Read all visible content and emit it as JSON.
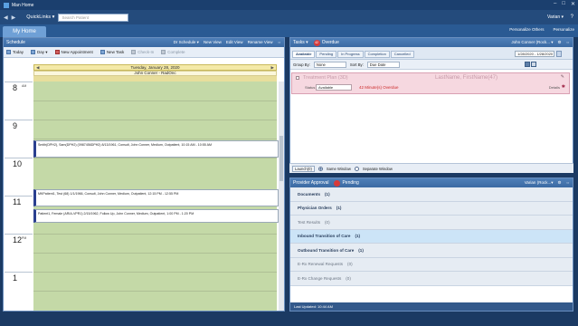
{
  "window": {
    "title": "Man Home",
    "controls": [
      "–",
      "□",
      "✕"
    ]
  },
  "toolbar": {
    "back": "◀",
    "forward": "▶",
    "quicklinks": "QuickLinks ▾",
    "search_placeholder": "Search Patient",
    "user": "Varian ▾",
    "help": "?"
  },
  "tabs": {
    "my_home": "My Home",
    "personalize_others": "Personalize Others",
    "personalize": "Personalize"
  },
  "schedule": {
    "title": "Schedule",
    "header_links": [
      "Dr Schedule ▾",
      "New View",
      "Edit View",
      "Rename View",
      "⇔"
    ],
    "tools": {
      "today": "Today",
      "view": "Day ▾",
      "new_appointment": "New Appointment",
      "new_task": "New Task",
      "check_in": "Check-In",
      "complete": "Complete"
    },
    "date": "Tuesday, January 28, 2020",
    "provider": "John Conner - RadOnc",
    "hours": [
      {
        "h": "8",
        "ampm": "AM"
      },
      {
        "h": "9",
        "ampm": ""
      },
      {
        "h": "10",
        "ampm": ""
      },
      {
        "h": "11",
        "ampm": ""
      },
      {
        "h": "12",
        "ampm": "PM"
      },
      {
        "h": "1",
        "ampm": ""
      }
    ],
    "appointments": [
      "Smith(DPH2), Sam(DPH2) (0987456DPH2) 8/13/1961, Consult, John Conner, Medium, Outpatient, 10:15 AM - 10:55 AM",
      "MKPatient1, Test (68) 1/1/1966, Consult, John Conner, Medium, Outpatient, 12:15 PM - 12:55 PM",
      "Patient1, Female (ARIA-VPR1) 2/15/1962, Follow Up, John Conner, Medium, Outpatient, 1:00 PM - 1:20 PM"
    ]
  },
  "tasks": {
    "title": "Tasks ▾",
    "badge": "42",
    "overdue_label": "Overdue",
    "provider_select": "John Conner (Rock... ▾",
    "tabs": [
      "Available",
      "Pending",
      "In Progress",
      "Completion",
      "Cancelled"
    ],
    "date_range": "1/28/2020 - 1/28/2020",
    "group_by_label": "Group By:",
    "group_by_value": "None",
    "sort_by_label": "Sort By:",
    "sort_by_value": "Due Date",
    "card": {
      "title": "Treatment Plan (3D)",
      "patient": "LastName, FirstName(47)",
      "status_label": "Status",
      "status_value": "Available",
      "overdue": "42 Minute(s) Overdue",
      "details": "Details"
    },
    "launch": {
      "launch_btn": "Launch(0)",
      "same_window": "Same Window",
      "separate_window": "Separate Window"
    }
  },
  "approval": {
    "title": "Provider Approval",
    "pending_label": "Pending",
    "provider_select": "Varian (Rock...▾",
    "rows": [
      {
        "label": "Documents",
        "count": "(1)",
        "style": "normal"
      },
      {
        "label": "Physician Orders",
        "count": "(1)",
        "style": "normal"
      },
      {
        "label": "Test Results",
        "count": "(0)",
        "style": "dim"
      },
      {
        "label": "Inbound Transition of Care",
        "count": "(1)",
        "style": "highlight"
      },
      {
        "label": "Outbound Transition of Care",
        "count": "(1)",
        "style": "normal"
      },
      {
        "label": "E-Rx Renewal Requests",
        "count": "(0)",
        "style": "dim"
      },
      {
        "label": "E-Rx Change Requests",
        "count": "(0)",
        "style": "dim"
      }
    ],
    "last_updated": "Last Updated: 10:44 AM"
  },
  "colors": {
    "calendar_green": "#c4d9a7",
    "card_pink": "#f6d8e0",
    "header_blue": "#3b6aa3",
    "overdue_red": "#cc2a2a"
  }
}
